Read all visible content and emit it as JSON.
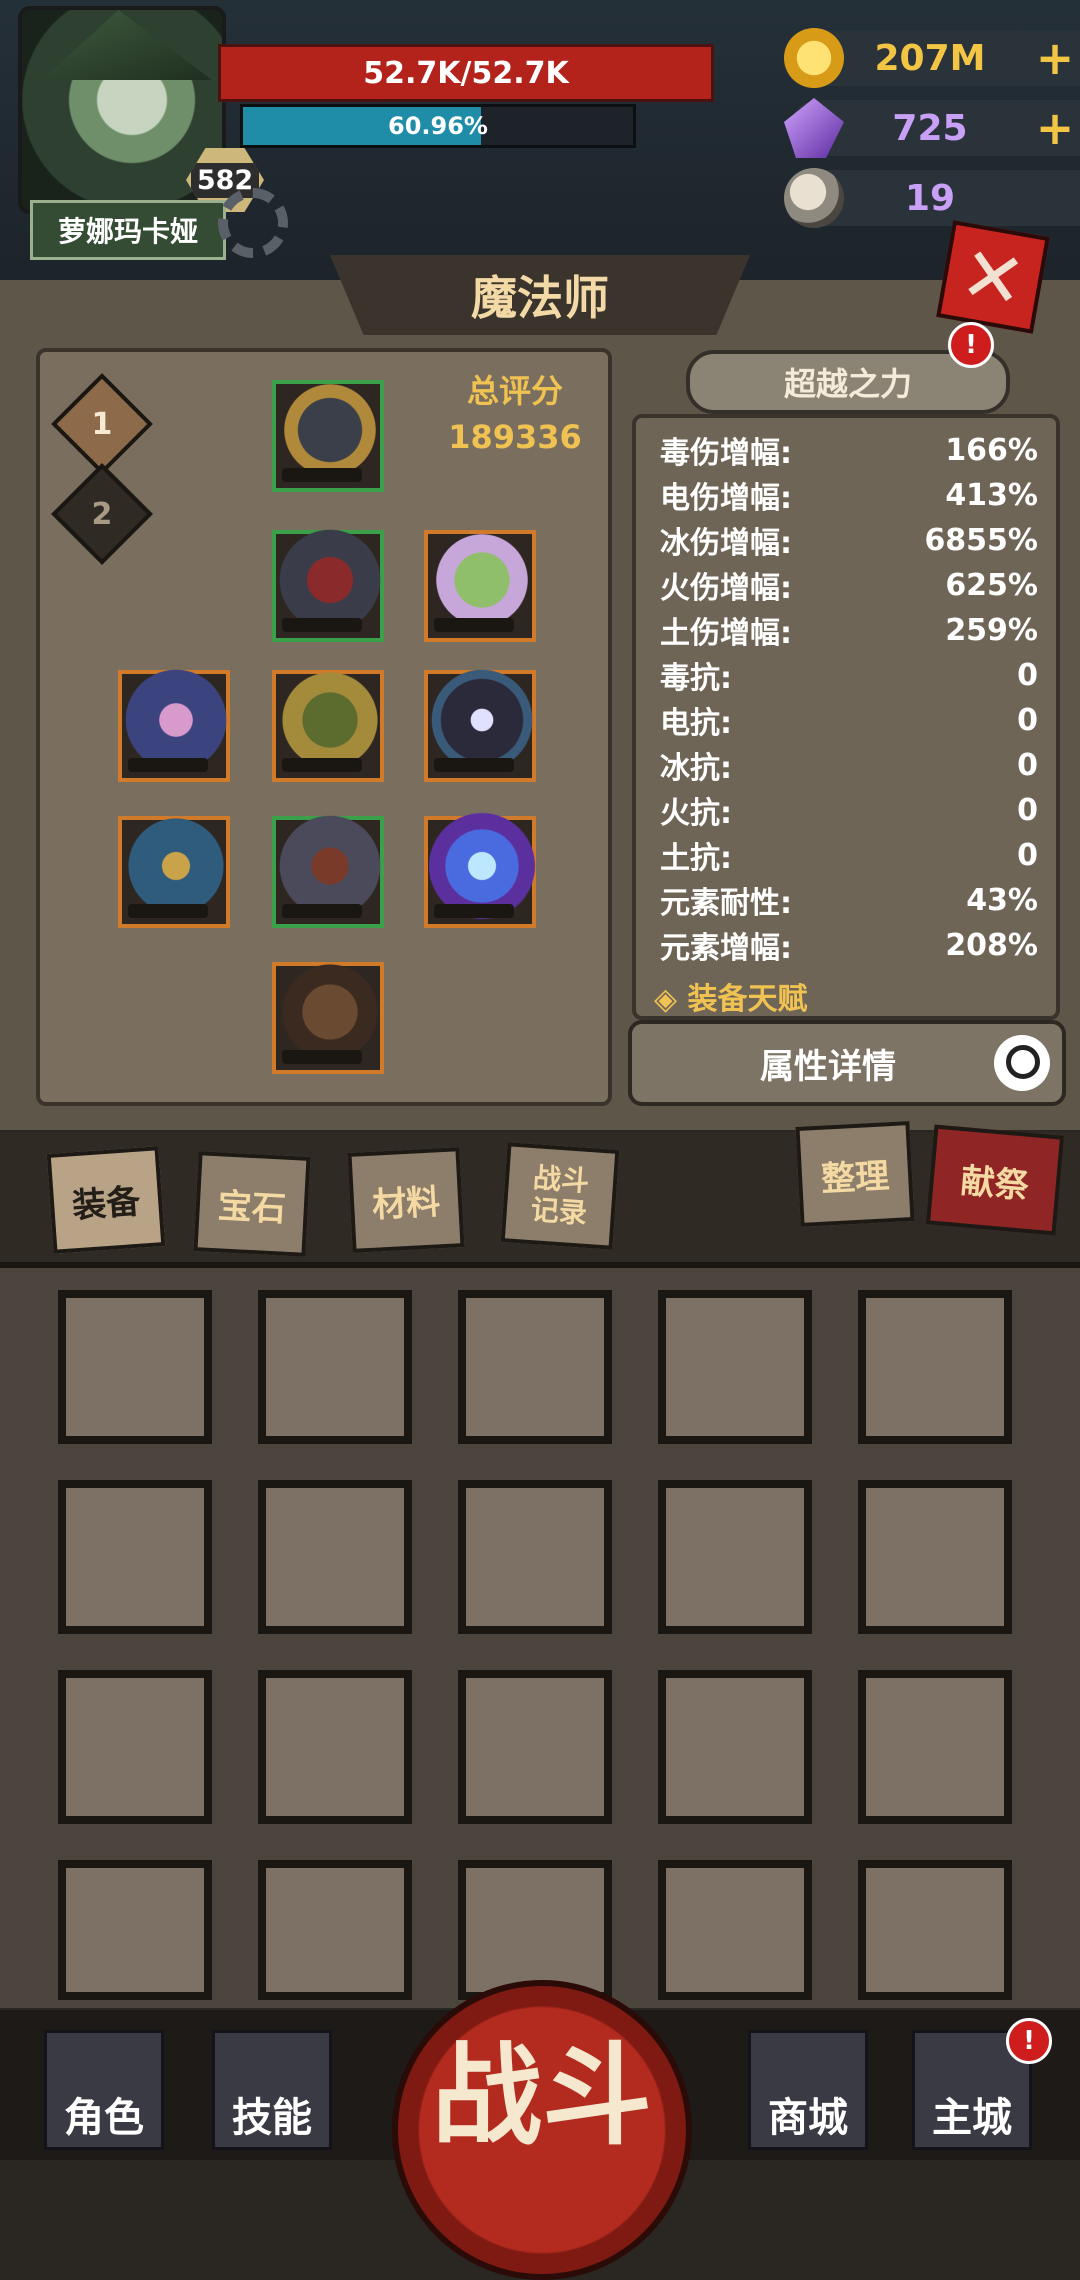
{
  "player": {
    "name": "萝娜玛卡娅",
    "level": "582",
    "hp_text": "52.7K/52.7K",
    "mp_percent": 60.96,
    "mp_text": "60.96%"
  },
  "resources": {
    "gold": "207M",
    "crystal": "725",
    "skull": "19",
    "plus": "+"
  },
  "colors": {
    "hp": "#b3231b",
    "mp": "#1f8ca8",
    "accent": "#f0c252",
    "close": "#c7231f"
  },
  "panel": {
    "title": "魔法师",
    "close_icon": "✕",
    "loadouts": [
      "1",
      "2"
    ],
    "total_score_label": "总评分",
    "total_score_value": "189336",
    "beyond_button": "超越之力",
    "alert_mark": "!"
  },
  "stats": [
    {
      "label": "毒伤增幅:",
      "value": "166%"
    },
    {
      "label": "电伤增幅:",
      "value": "413%"
    },
    {
      "label": "冰伤增幅:",
      "value": "6855%"
    },
    {
      "label": "火伤增幅:",
      "value": "625%"
    },
    {
      "label": "土伤增幅:",
      "value": "259%"
    },
    {
      "label": "毒抗:",
      "value": "0"
    },
    {
      "label": "电抗:",
      "value": "0"
    },
    {
      "label": "冰抗:",
      "value": "0"
    },
    {
      "label": "火抗:",
      "value": "0"
    },
    {
      "label": "土抗:",
      "value": "0"
    },
    {
      "label": "元素耐性:",
      "value": "43%"
    },
    {
      "label": "元素增幅:",
      "value": "208%"
    }
  ],
  "talent_label": "◈ 装备天赋",
  "detail_button": "属性详情",
  "tabs": {
    "equipment": "装备",
    "gems": "宝石",
    "materials": "材料",
    "battle_log_1": "战斗",
    "battle_log_2": "记录",
    "sort": "整理",
    "sacrifice": "献祭"
  },
  "nav": {
    "role": "角色",
    "skill": "技能",
    "fight": "战斗",
    "shop": "商城",
    "city": "主城"
  }
}
